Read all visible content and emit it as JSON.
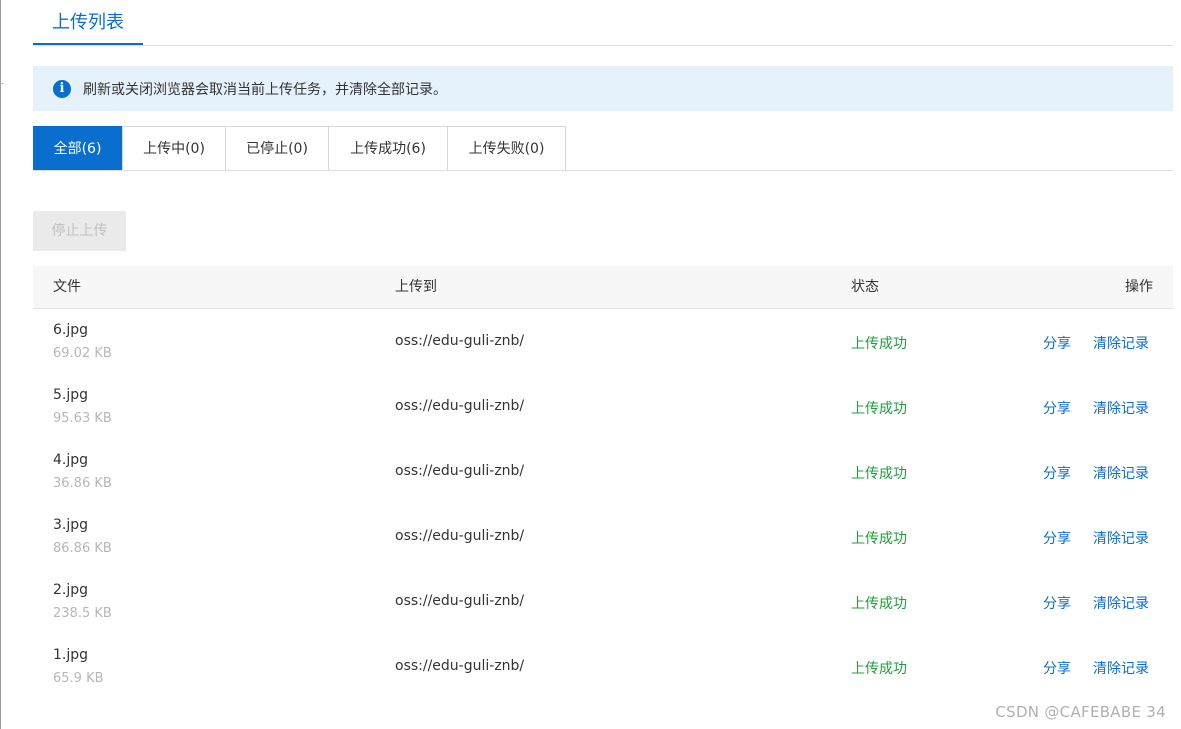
{
  "page_title": "上传列表",
  "notice": {
    "icon": "info-icon",
    "text": "刷新或关闭浏览器会取消当前上传任务，并清除全部记录。"
  },
  "filter_tabs": [
    {
      "label": "全部(6)",
      "active": true
    },
    {
      "label": "上传中(0)",
      "active": false
    },
    {
      "label": "已停止(0)",
      "active": false
    },
    {
      "label": "上传成功(6)",
      "active": false
    },
    {
      "label": "上传失败(0)",
      "active": false
    }
  ],
  "toolbar": {
    "stop_label": "停止上传"
  },
  "table": {
    "headers": {
      "file": "文件",
      "destination": "上传到",
      "status": "状态",
      "actions": "操作"
    },
    "rows": [
      {
        "name": "6.jpg",
        "size": "69.02 KB",
        "destination": "oss://edu-guli-znb/",
        "status": "上传成功",
        "share": "分享",
        "clear": "清除记录"
      },
      {
        "name": "5.jpg",
        "size": "95.63 KB",
        "destination": "oss://edu-guli-znb/",
        "status": "上传成功",
        "share": "分享",
        "clear": "清除记录"
      },
      {
        "name": "4.jpg",
        "size": "36.86 KB",
        "destination": "oss://edu-guli-znb/",
        "status": "上传成功",
        "share": "分享",
        "clear": "清除记录"
      },
      {
        "name": "3.jpg",
        "size": "86.86 KB",
        "destination": "oss://edu-guli-znb/",
        "status": "上传成功",
        "share": "分享",
        "clear": "清除记录"
      },
      {
        "name": "2.jpg",
        "size": "238.5 KB",
        "destination": "oss://edu-guli-znb/",
        "status": "上传成功",
        "share": "分享",
        "clear": "清除记录"
      },
      {
        "name": "1.jpg",
        "size": "65.9 KB",
        "destination": "oss://edu-guli-znb/",
        "status": "上传成功",
        "share": "分享",
        "clear": "清除记录"
      }
    ]
  },
  "colors": {
    "accent": "#0a6ece",
    "success": "#21a03c",
    "notice_bg": "#e6f2fb"
  },
  "watermark": "CSDN @CAFEBABE 34"
}
